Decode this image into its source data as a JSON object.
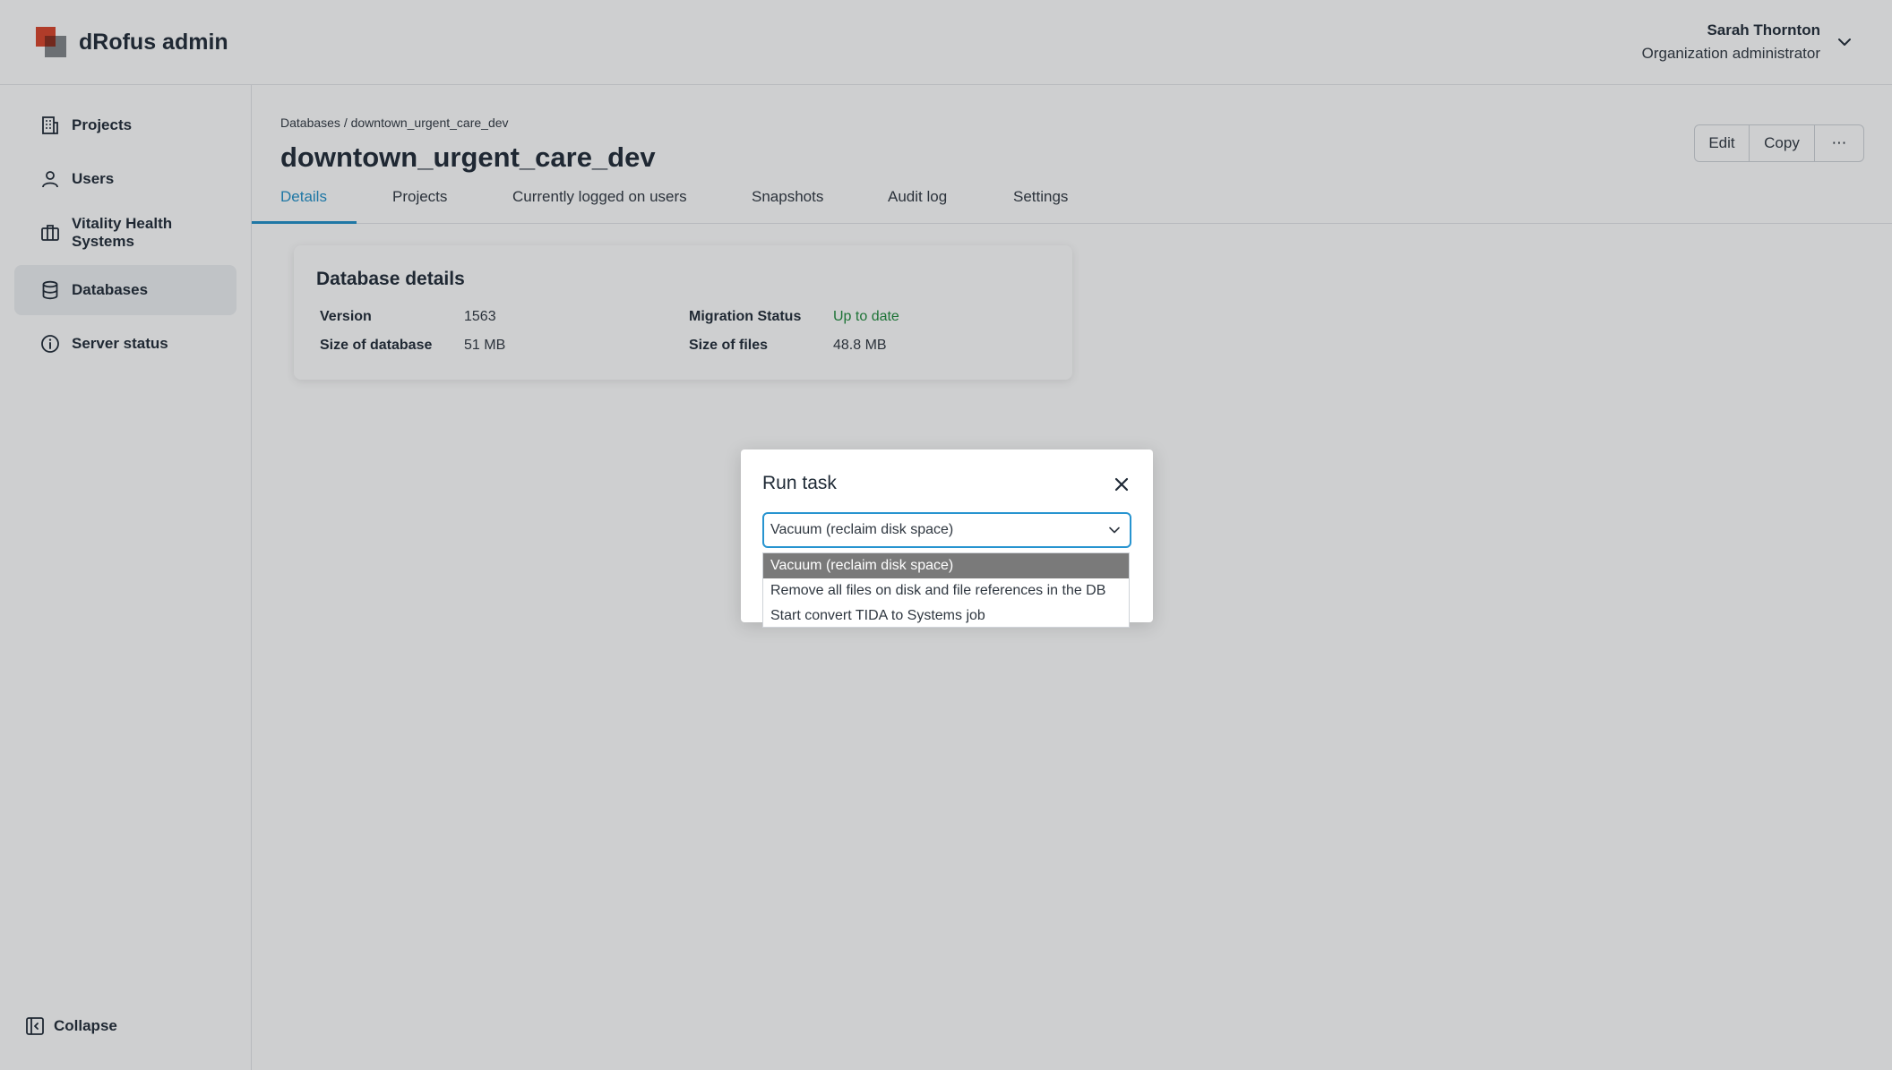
{
  "header": {
    "app_title": "dRofus admin",
    "user_name": "Sarah Thornton",
    "user_role": "Organization administrator"
  },
  "sidebar": {
    "items": [
      {
        "label": "Projects",
        "icon": "building-icon",
        "active": false
      },
      {
        "label": "Users",
        "icon": "user-icon",
        "active": false
      },
      {
        "label": "Vitality Health Systems",
        "icon": "briefcase-icon",
        "active": false
      },
      {
        "label": "Databases",
        "icon": "database-icon",
        "active": true
      },
      {
        "label": "Server status",
        "icon": "info-icon",
        "active": false
      }
    ],
    "collapse_label": "Collapse"
  },
  "breadcrumb": {
    "root": "Databases",
    "separator": "/",
    "current": "downtown_urgent_care_dev"
  },
  "page": {
    "title": "downtown_urgent_care_dev",
    "actions": {
      "edit": "Edit",
      "copy": "Copy",
      "more": "⋯"
    }
  },
  "tabs": [
    {
      "label": "Details",
      "active": true
    },
    {
      "label": "Projects",
      "active": false
    },
    {
      "label": "Currently logged on users",
      "active": false
    },
    {
      "label": "Snapshots",
      "active": false
    },
    {
      "label": "Audit log",
      "active": false
    },
    {
      "label": "Settings",
      "active": false
    }
  ],
  "details_card": {
    "title": "Database details",
    "version_label": "Version",
    "version_value": "1563",
    "size_db_label": "Size of database",
    "size_db_value": "51 MB",
    "migration_label": "Migration Status",
    "migration_value": "Up to date",
    "size_files_label": "Size of files",
    "size_files_value": "48.8 MB"
  },
  "modal": {
    "title": "Run task",
    "selected_value": "Vacuum (reclaim disk space)",
    "options": [
      "Vacuum (reclaim disk space)",
      "Remove all files on disk and file references in the DB",
      "Start convert TIDA to Systems job"
    ]
  },
  "colors": {
    "accent": "#1f8fc8",
    "status_ok": "#1e8a3c",
    "logo_red": "#d9432a",
    "logo_gray": "#6b6f73"
  }
}
